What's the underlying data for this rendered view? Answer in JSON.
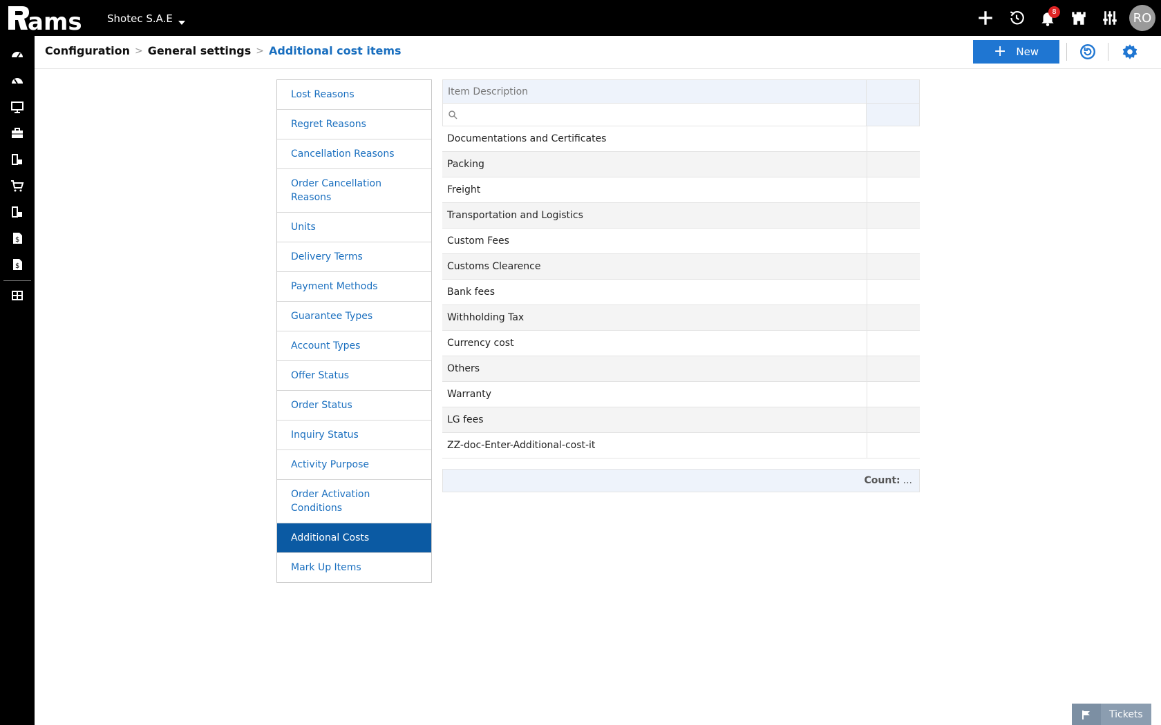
{
  "topbar": {
    "company": "Shotec S.A.E",
    "notification_count": "8",
    "user_initials": "RO"
  },
  "breadcrumb": {
    "items": [
      "Configuration",
      "General settings",
      "Additional cost items"
    ]
  },
  "header": {
    "new_label": "New"
  },
  "menu": {
    "items": [
      "Lost Reasons",
      "Regret Reasons",
      "Cancellation Reasons",
      "Order Cancellation Reasons",
      "Units",
      "Delivery Terms",
      "Payment Methods",
      "Guarantee Types",
      "Account Types",
      "Offer Status",
      "Order Status",
      "Inquiry Status",
      "Activity Purpose",
      "Order Activation Conditions",
      "Additional Costs",
      "Mark Up Items"
    ],
    "active": "Additional Costs"
  },
  "grid": {
    "column_header": "Item Description",
    "rows": [
      "Documentations and Certificates",
      "Packing",
      "Freight",
      "Transportation and Logistics",
      "Custom Fees",
      "Customs Clearence",
      "Bank fees",
      "Withholding Tax",
      "Currency cost",
      "Others",
      "Warranty",
      "LG fees",
      "ZZ-doc-Enter-Additional-cost-it"
    ],
    "count_label": "Count:",
    "count_value": "..."
  },
  "tickets": {
    "label": "Tickets"
  },
  "colors": {
    "accent": "#1f76d2",
    "active_menu": "#0b5aa3",
    "link": "#1a6fbf",
    "topbar": "#000000"
  }
}
